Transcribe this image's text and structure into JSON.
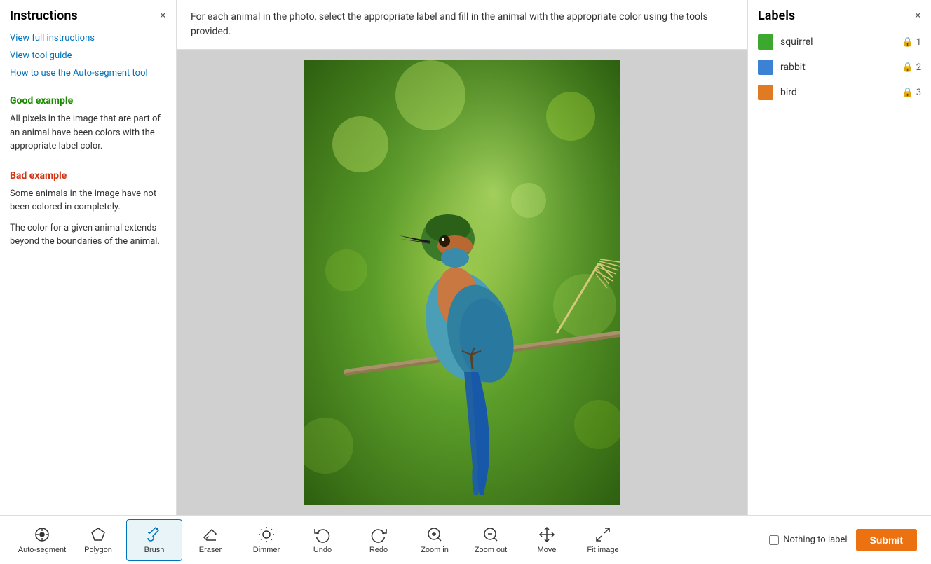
{
  "left_panel": {
    "title": "Instructions",
    "close_label": "×",
    "links": [
      {
        "id": "view-full",
        "text": "View full instructions"
      },
      {
        "id": "view-tool",
        "text": "View tool guide"
      },
      {
        "id": "auto-segment",
        "text": "How to use the Auto-segment tool"
      }
    ],
    "good_example_title": "Good example",
    "good_example_text": "All pixels in the image that are part of an animal have been colors with the appropriate label color.",
    "bad_example_title": "Bad example",
    "bad_example_text1": "Some animals in the image have not been colored in completely.",
    "bad_example_text2": "The color for a given animal extends beyond the boundaries of the animal."
  },
  "instruction_bar": {
    "text": "For each animal in the photo, select the appropriate label and fill in the animal with the appropriate color using the tools provided."
  },
  "right_panel": {
    "title": "Labels",
    "close_label": "×",
    "labels": [
      {
        "id": "squirrel",
        "name": "squirrel",
        "color": "#3da830",
        "count": "1"
      },
      {
        "id": "rabbit",
        "name": "rabbit",
        "color": "#3b82d4",
        "count": "2"
      },
      {
        "id": "bird",
        "name": "bird",
        "color": "#e07b22",
        "count": "3"
      }
    ]
  },
  "toolbar": {
    "tools": [
      {
        "id": "auto-segment",
        "label": "Auto-segment",
        "icon": "auto-segment-icon"
      },
      {
        "id": "polygon",
        "label": "Polygon",
        "icon": "polygon-icon"
      },
      {
        "id": "brush",
        "label": "Brush",
        "icon": "brush-icon",
        "active": true
      },
      {
        "id": "eraser",
        "label": "Eraser",
        "icon": "eraser-icon"
      },
      {
        "id": "dimmer",
        "label": "Dimmer",
        "icon": "dimmer-icon"
      },
      {
        "id": "undo",
        "label": "Undo",
        "icon": "undo-icon"
      },
      {
        "id": "redo",
        "label": "Redo",
        "icon": "redo-icon"
      },
      {
        "id": "zoom-in",
        "label": "Zoom in",
        "icon": "zoom-in-icon"
      },
      {
        "id": "zoom-out",
        "label": "Zoom out",
        "icon": "zoom-out-icon"
      },
      {
        "id": "move",
        "label": "Move",
        "icon": "move-icon"
      },
      {
        "id": "fit-image",
        "label": "Fit image",
        "icon": "fit-image-icon"
      }
    ],
    "nothing_to_label": "Nothing to label",
    "submit_label": "Submit"
  }
}
